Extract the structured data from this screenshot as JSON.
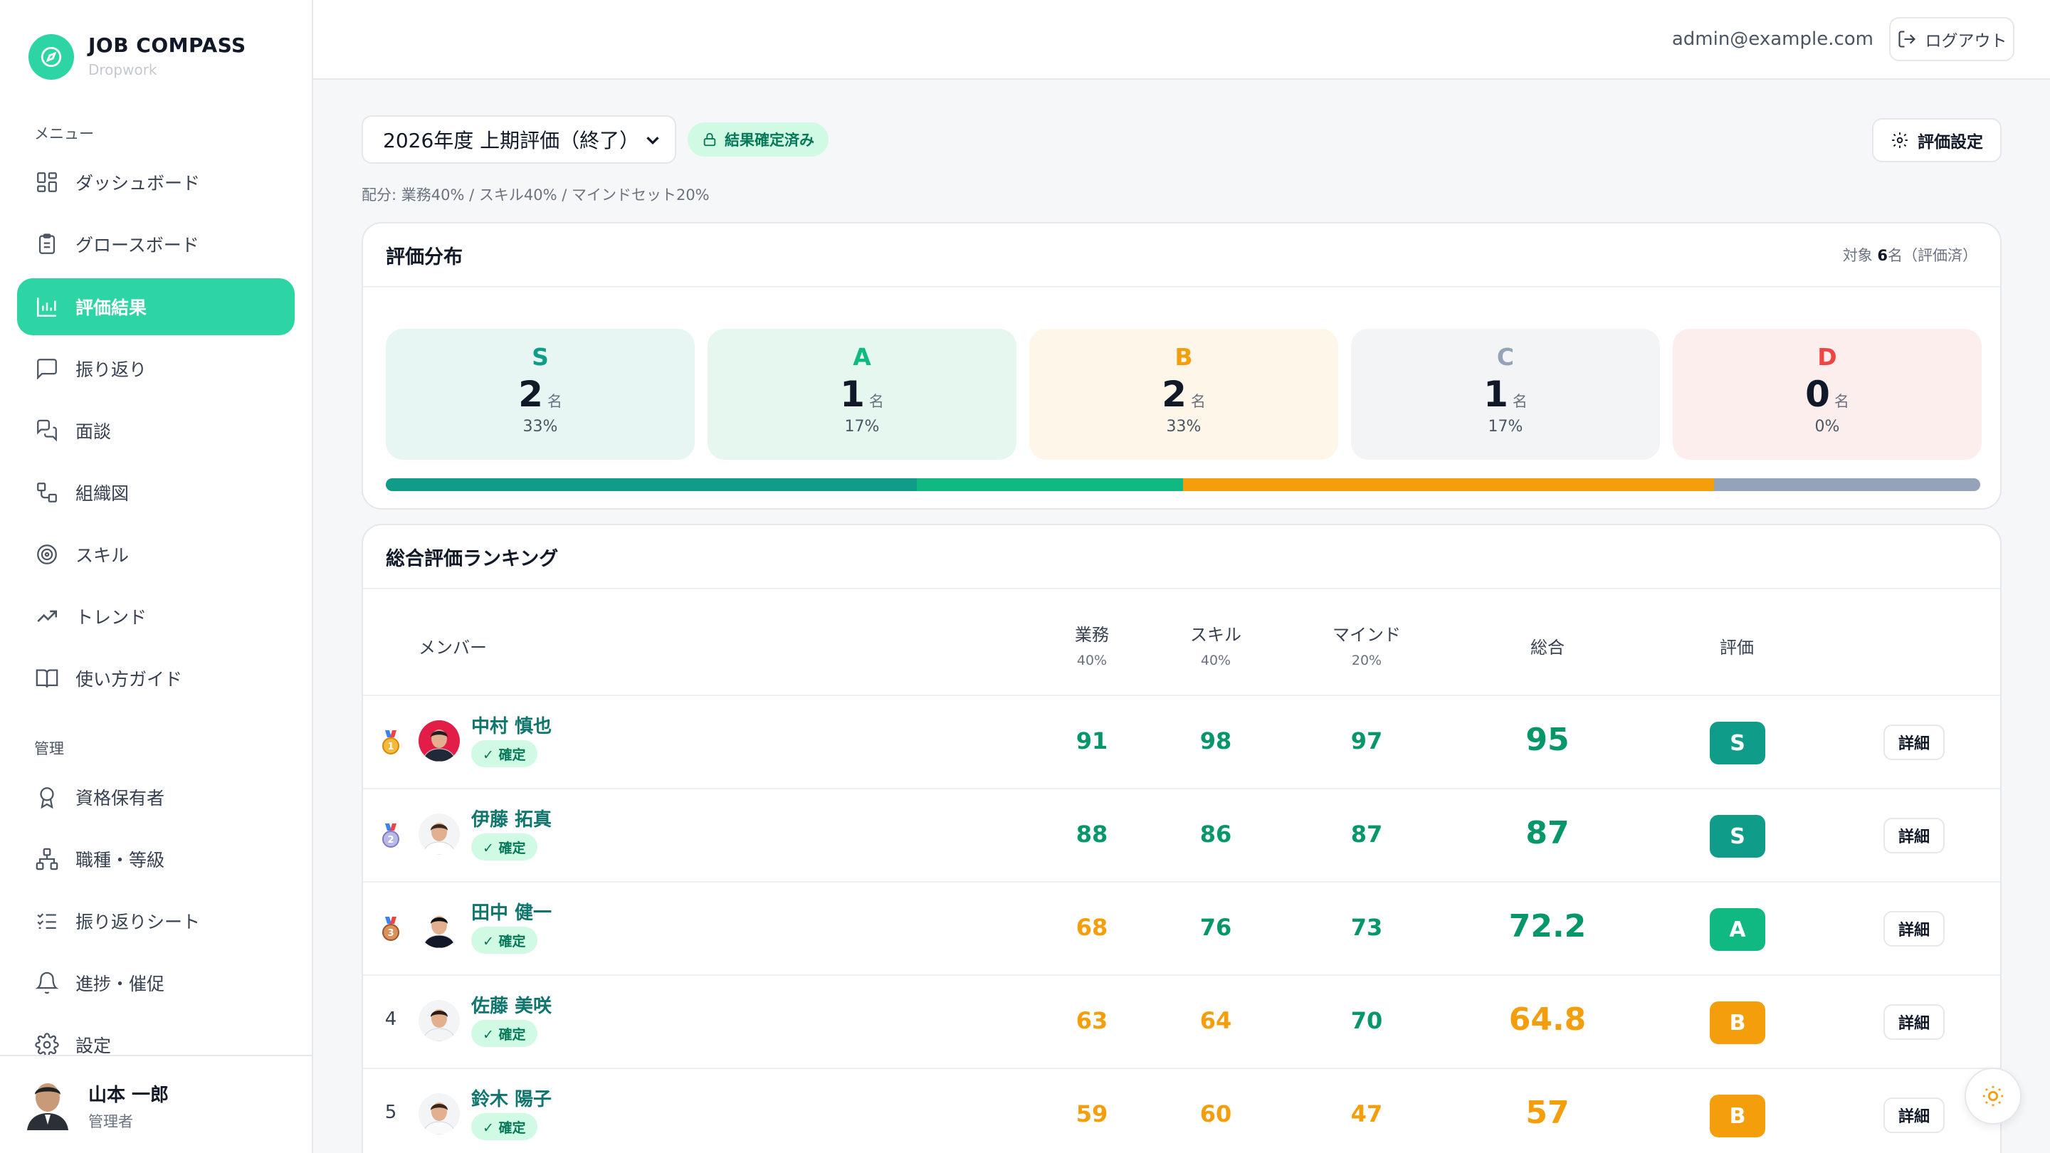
{
  "brand": {
    "title": "JOB COMPASS",
    "subtitle": "Dropwork",
    "logo_icon": "compass-icon"
  },
  "sidebar": {
    "menu_label": "メニュー",
    "admin_label": "管理",
    "items": [
      {
        "label": "ダッシュボード",
        "icon": "dashboard-icon",
        "active": false
      },
      {
        "label": "グロースボード",
        "icon": "clipboard-icon",
        "active": false
      },
      {
        "label": "評価結果",
        "icon": "bar-chart-icon",
        "active": true
      },
      {
        "label": "振り返り",
        "icon": "message-square-icon",
        "active": false
      },
      {
        "label": "面談",
        "icon": "messages-icon",
        "active": false
      },
      {
        "label": "組織図",
        "icon": "org-chart-icon",
        "active": false
      },
      {
        "label": "スキル",
        "icon": "target-icon",
        "active": false
      },
      {
        "label": "トレンド",
        "icon": "trending-up-icon",
        "active": false
      },
      {
        "label": "使い方ガイド",
        "icon": "book-icon",
        "active": false
      }
    ],
    "admin_items": [
      {
        "label": "資格保有者",
        "icon": "award-icon"
      },
      {
        "label": "職種・等級",
        "icon": "hierarchy-icon"
      },
      {
        "label": "振り返りシート",
        "icon": "checklist-icon"
      },
      {
        "label": "進捗・催促",
        "icon": "bell-icon"
      },
      {
        "label": "設定",
        "icon": "gear-icon"
      }
    ],
    "user": {
      "name": "山本 一郎",
      "role": "管理者"
    }
  },
  "topbar": {
    "email": "admin@example.com",
    "logout_label": "ログアウト"
  },
  "main": {
    "period_value": "2026年度 上期評価（終了）",
    "status_badge": "結果確定済み",
    "settings_label": "評価設定",
    "weights_text": "配分: 業務40% / スキル40% / マインドセット20%"
  },
  "distribution": {
    "title": "評価分布",
    "meta_prefix": "対象 ",
    "meta_count": "6",
    "meta_suffix": "名（評価済）",
    "unit": "名",
    "grades": [
      {
        "letter": "S",
        "count": "2",
        "pct": "33%",
        "color": "#0f9d8a",
        "bg": "#e7f6f3",
        "share": 0.333
      },
      {
        "letter": "A",
        "count": "1",
        "pct": "17%",
        "color": "#10b981",
        "bg": "#e6f7f0",
        "share": 0.167
      },
      {
        "letter": "B",
        "count": "2",
        "pct": "33%",
        "color": "#f59e0b",
        "bg": "#fdf6e9",
        "share": 0.333
      },
      {
        "letter": "C",
        "count": "1",
        "pct": "17%",
        "color": "#94a3b8",
        "bg": "#f3f4f6",
        "share": 0.167
      },
      {
        "letter": "D",
        "count": "0",
        "pct": "0%",
        "color": "#ef4444",
        "bg": "#fdeeee",
        "share": 0
      }
    ]
  },
  "ranking": {
    "title": "総合評価ランキング",
    "headers": {
      "member": "メンバー",
      "work": "業務",
      "work_weight": "40%",
      "skill": "スキル",
      "skill_weight": "40%",
      "mind": "マインド",
      "mind_weight": "20%",
      "total": "総合",
      "grade": "評価"
    },
    "confirmed_label": "✓ 確定",
    "detail_label": "詳細",
    "rows": [
      {
        "rank": "1",
        "medal": "gold",
        "name": "中村 慎也",
        "work": "91",
        "skill": "98",
        "mind": "97",
        "total": "95",
        "grade": "S",
        "grade_color": "#0f9d8a",
        "work_tone": "green",
        "skill_tone": "green",
        "mind_tone": "green",
        "total_tone": "green"
      },
      {
        "rank": "2",
        "medal": "silver",
        "name": "伊藤 拓真",
        "work": "88",
        "skill": "86",
        "mind": "87",
        "total": "87",
        "grade": "S",
        "grade_color": "#0f9d8a",
        "work_tone": "green",
        "skill_tone": "green",
        "mind_tone": "green",
        "total_tone": "green"
      },
      {
        "rank": "3",
        "medal": "bronze",
        "name": "田中 健一",
        "work": "68",
        "skill": "76",
        "mind": "73",
        "total": "72.2",
        "grade": "A",
        "grade_color": "#10b981",
        "work_tone": "amber",
        "skill_tone": "green",
        "mind_tone": "green",
        "total_tone": "green"
      },
      {
        "rank": "4",
        "medal": "",
        "name": "佐藤 美咲",
        "work": "63",
        "skill": "64",
        "mind": "70",
        "total": "64.8",
        "grade": "B",
        "grade_color": "#f59e0b",
        "work_tone": "amber",
        "skill_tone": "amber",
        "mind_tone": "green",
        "total_tone": "amber"
      },
      {
        "rank": "5",
        "medal": "",
        "name": "鈴木 陽子",
        "work": "59",
        "skill": "60",
        "mind": "47",
        "total": "57",
        "grade": "B",
        "grade_color": "#f59e0b",
        "work_tone": "amber",
        "skill_tone": "amber",
        "mind_tone": "amber",
        "total_tone": "amber"
      }
    ]
  }
}
